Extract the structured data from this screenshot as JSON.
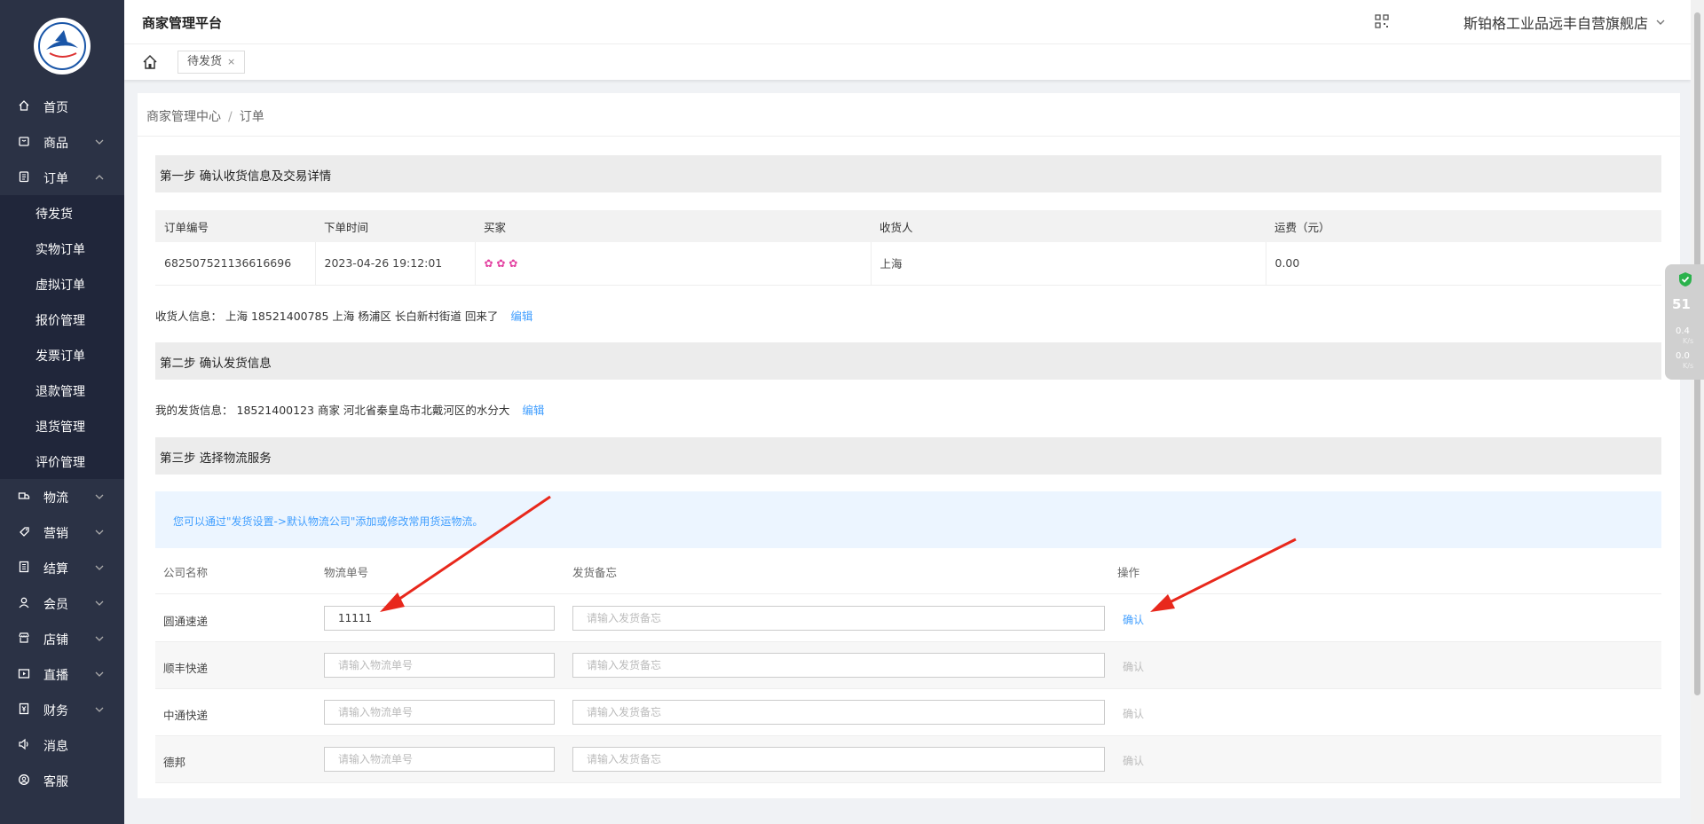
{
  "header": {
    "app_title": "商家管理平台",
    "store_name": "斯铂格工业品远丰自营旗舰店"
  },
  "tabs": [
    {
      "label": "待发货",
      "close": "×"
    }
  ],
  "breadcrumb": {
    "items": [
      "商家管理中心",
      "订单"
    ],
    "separator": "/"
  },
  "sidebar": {
    "items": [
      {
        "label": "首页",
        "icon": "home-icon"
      },
      {
        "label": "商品",
        "icon": "goods-icon"
      },
      {
        "label": "订单",
        "icon": "order-icon",
        "expanded": true
      },
      {
        "label": "物流",
        "icon": "truck-icon"
      },
      {
        "label": "营销",
        "icon": "coupon-icon"
      },
      {
        "label": "结算",
        "icon": "ledger-icon"
      },
      {
        "label": "会员",
        "icon": "user-icon"
      },
      {
        "label": "店铺",
        "icon": "store-icon"
      },
      {
        "label": "直播",
        "icon": "live-icon"
      },
      {
        "label": "财务",
        "icon": "finance-icon"
      },
      {
        "label": "消息",
        "icon": "speaker-icon"
      },
      {
        "label": "客服",
        "icon": "service-icon"
      }
    ],
    "order_sub": [
      "待发货",
      "实物订单",
      "虚拟订单",
      "报价管理",
      "发票订单",
      "退款管理",
      "退货管理",
      "评价管理"
    ]
  },
  "main": {
    "step1": {
      "title": "第一步 确认收货信息及交易详情",
      "columns": [
        "订单编号",
        "下单时间",
        "买家",
        "收货人",
        "运费（元）"
      ],
      "row": {
        "order_no": "682507521136616696",
        "time": "2023-04-26 19:12:01",
        "buyer": "✿ ✿ ✿",
        "receiver": "上海",
        "freight": "0.00"
      },
      "receiver_info_label": "收货人信息：",
      "receiver_info": "上海 18521400785 上海 杨浦区 长白新村街道 回来了",
      "edit": "编辑"
    },
    "step2": {
      "title": "第二步 确认发货信息",
      "sender_label": "我的发货信息：",
      "sender_info": "18521400123 商家 河北省秦皇岛市北戴河区的水分大",
      "edit": "编辑"
    },
    "step3": {
      "title": "第三步 选择物流服务",
      "tip": "您可以通过\"发货设置->默认物流公司\"添加或修改常用货运物流。",
      "columns": [
        "公司名称",
        "物流单号",
        "发货备忘",
        "操作"
      ],
      "no_placeholder": "请输入物流单号",
      "memo_placeholder": "请输入发货备忘",
      "confirm": "确认",
      "rows": [
        {
          "company": "圆通速递",
          "tracking_no": "11111",
          "active": true
        },
        {
          "company": "顺丰快递",
          "tracking_no": "",
          "active": false
        },
        {
          "company": "中通快递",
          "tracking_no": "",
          "active": false
        },
        {
          "company": "德邦",
          "tracking_no": "",
          "active": false
        }
      ]
    }
  },
  "net_widget": {
    "percent": "51",
    "up": "0.4",
    "down": "0.0",
    "unit": "K/s"
  },
  "colors": {
    "sidebar_bg": "#2b3245",
    "submenu_bg": "#20263a",
    "link": "#409eff",
    "arrow": "#e8281c"
  }
}
